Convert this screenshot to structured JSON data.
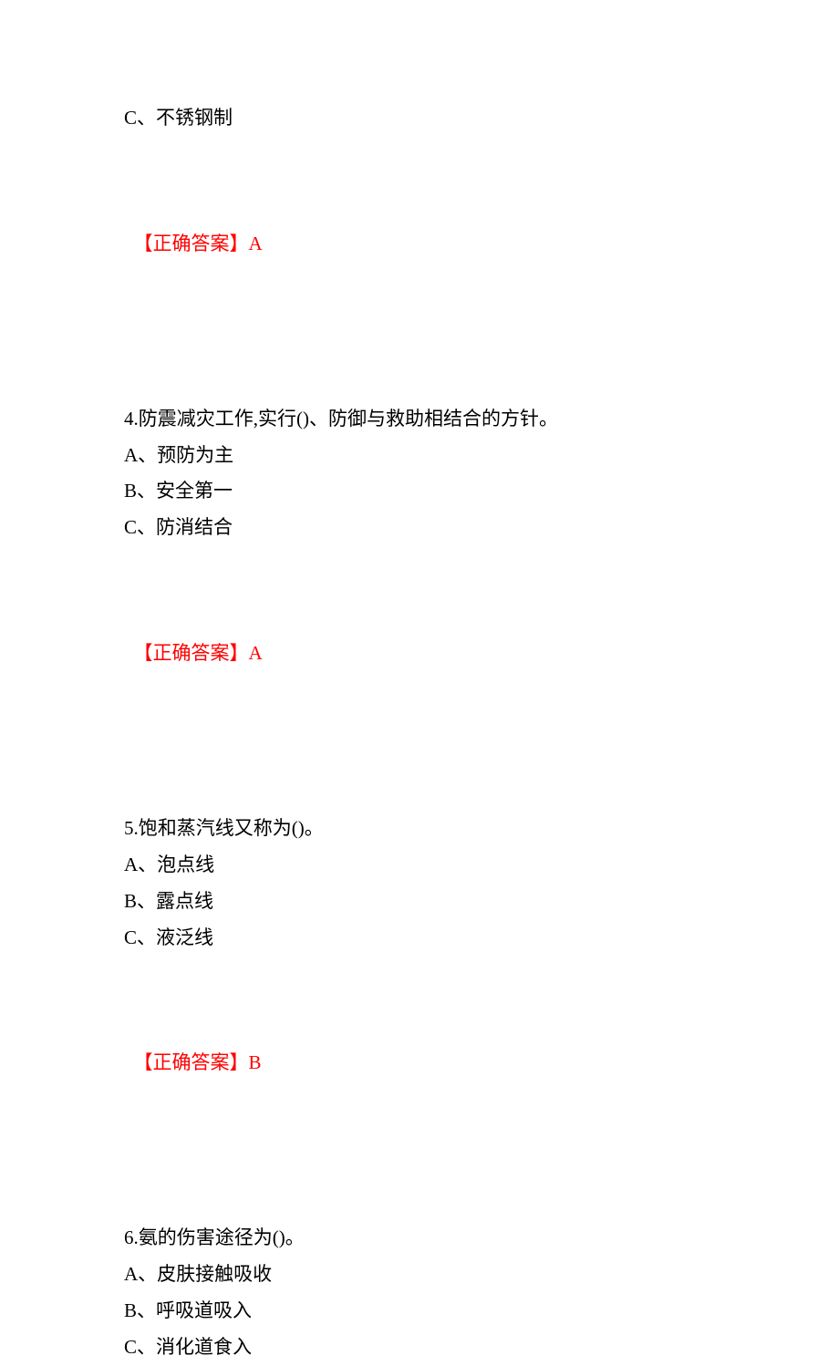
{
  "q3": {
    "option_c": "C、不锈钢制",
    "answer_label": "【正确答案】",
    "answer_value": "A"
  },
  "q4": {
    "stem": "4.防震减灾工作,实行()、防御与救助相结合的方针。",
    "option_a": "A、预防为主",
    "option_b": "B、安全第一",
    "option_c": "C、防消结合",
    "answer_label": "【正确答案】",
    "answer_value": "A"
  },
  "q5": {
    "stem": "5.饱和蒸汽线又称为()。",
    "option_a": "A、泡点线",
    "option_b": "B、露点线",
    "option_c": "C、液泛线",
    "answer_label": "【正确答案】",
    "answer_value": "B"
  },
  "q6": {
    "stem": "6.氨的伤害途径为()。",
    "option_a": "A、皮肤接触吸收",
    "option_b": "B、呼吸道吸入",
    "option_c": "C、消化道食入"
  }
}
